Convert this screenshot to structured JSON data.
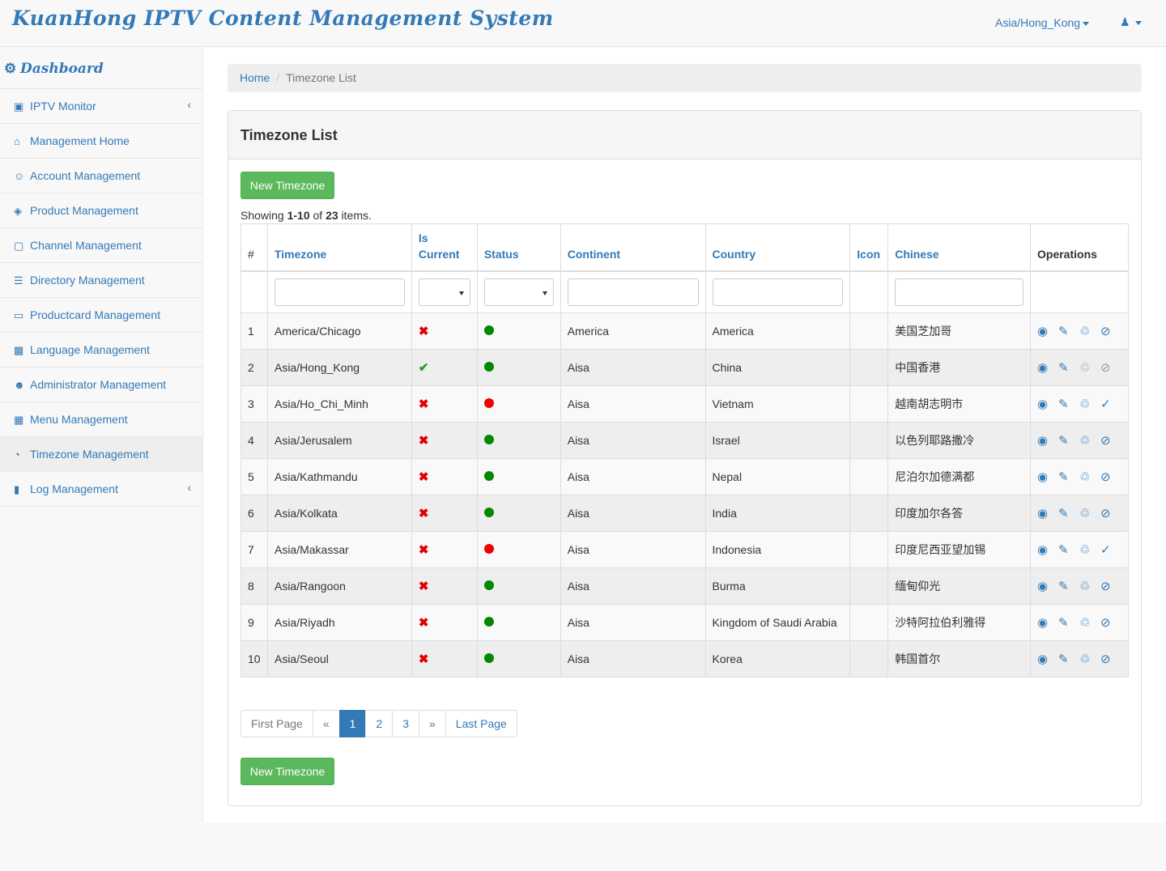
{
  "header": {
    "brand": "KuanHong IPTV Content Management System",
    "timezone": "Asia/Hong_Kong",
    "user_icon": "user-icon"
  },
  "sidebar": {
    "title": "Dashboard",
    "title_icon": "dashboard-icon",
    "items": [
      {
        "label": "IPTV Monitor",
        "icon": "monitor-icon",
        "expandable": true
      },
      {
        "label": "Management Home",
        "icon": "home-icon"
      },
      {
        "label": "Account Management",
        "icon": "user-gear-icon"
      },
      {
        "label": "Product Management",
        "icon": "box-icon"
      },
      {
        "label": "Channel Management",
        "icon": "channel-icon"
      },
      {
        "label": "Directory Management",
        "icon": "list-icon"
      },
      {
        "label": "Productcard Management",
        "icon": "card-icon"
      },
      {
        "label": "Language Management",
        "icon": "language-icon"
      },
      {
        "label": "Administrator Management",
        "icon": "admin-icon"
      },
      {
        "label": "Menu Management",
        "icon": "menu-icon"
      },
      {
        "label": "Timezone Management",
        "icon": "timezone-icon",
        "active": true
      },
      {
        "label": "Log Management",
        "icon": "log-icon",
        "expandable": true
      }
    ]
  },
  "breadcrumb": {
    "home": "Home",
    "current": "Timezone List"
  },
  "panel": {
    "title": "Timezone List",
    "new_button": "New Timezone",
    "summary": {
      "prefix": "Showing ",
      "range": "1-10",
      "of": " of ",
      "total": "23",
      "suffix": " items."
    }
  },
  "table": {
    "headers": {
      "num": "#",
      "timezone": "Timezone",
      "is_current_1": "Is",
      "is_current_2": "Current",
      "status": "Status",
      "continent": "Continent",
      "country": "Country",
      "icon": "Icon",
      "chinese": "Chinese",
      "operations": "Operations"
    },
    "rows": [
      {
        "num": "1",
        "timezone": "America/Chicago",
        "current": false,
        "status": "green",
        "continent": "America",
        "country": "America",
        "chinese": "美国芝加哥",
        "toggle": "disable"
      },
      {
        "num": "2",
        "timezone": "Asia/Hong_Kong",
        "current": true,
        "status": "green",
        "continent": "Aisa",
        "country": "China",
        "chinese": "中国香港",
        "toggle": "disabled"
      },
      {
        "num": "3",
        "timezone": "Asia/Ho_Chi_Minh",
        "current": false,
        "status": "red",
        "continent": "Aisa",
        "country": "Vietnam",
        "chinese": "越南胡志明市",
        "toggle": "enable"
      },
      {
        "num": "4",
        "timezone": "Asia/Jerusalem",
        "current": false,
        "status": "green",
        "continent": "Aisa",
        "country": "Israel",
        "chinese": "以色列耶路撒冷",
        "toggle": "disable"
      },
      {
        "num": "5",
        "timezone": "Asia/Kathmandu",
        "current": false,
        "status": "green",
        "continent": "Aisa",
        "country": "Nepal",
        "chinese": "尼泊尔加德满都",
        "toggle": "disable"
      },
      {
        "num": "6",
        "timezone": "Asia/Kolkata",
        "current": false,
        "status": "green",
        "continent": "Aisa",
        "country": "India",
        "chinese": "印度加尔各答",
        "toggle": "disable"
      },
      {
        "num": "7",
        "timezone": "Asia/Makassar",
        "current": false,
        "status": "red",
        "continent": "Aisa",
        "country": "Indonesia",
        "chinese": "印度尼西亚望加锡",
        "toggle": "enable"
      },
      {
        "num": "8",
        "timezone": "Asia/Rangoon",
        "current": false,
        "status": "green",
        "continent": "Aisa",
        "country": "Burma",
        "chinese": "缅甸仰光",
        "toggle": "disable"
      },
      {
        "num": "9",
        "timezone": "Asia/Riyadh",
        "current": false,
        "status": "green",
        "continent": "Aisa",
        "country": "Kingdom of Saudi Arabia",
        "chinese": "沙特阿拉伯利雅得",
        "toggle": "disable"
      },
      {
        "num": "10",
        "timezone": "Asia/Seoul",
        "current": false,
        "status": "green",
        "continent": "Aisa",
        "country": "Korea",
        "chinese": "韩国首尔",
        "toggle": "disable"
      }
    ]
  },
  "pagination": {
    "first": "First Page",
    "prev": "«",
    "pages": [
      "1",
      "2",
      "3"
    ],
    "current": "1",
    "next": "»",
    "last": "Last Page"
  },
  "colors": {
    "primary": "#337ab7",
    "success": "#5cb85c",
    "status_on": "#008800",
    "status_off": "#ee0000",
    "cross": "#e00000",
    "check": "#229922"
  }
}
